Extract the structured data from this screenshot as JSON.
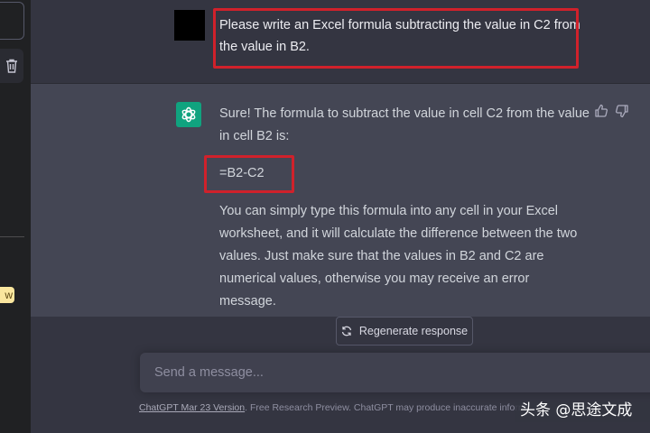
{
  "sidebar": {
    "badge_text": "w"
  },
  "user_message": {
    "text": "Please write an Excel formula subtracting the value in C2 from the value in B2."
  },
  "assistant_message": {
    "intro": "Sure! The formula to subtract the value in cell C2 from the value in cell B2 is:",
    "formula": "=B2-C2",
    "explanation": "You can simply type this formula into any cell in your Excel worksheet, and it will calculate the difference between the two values. Just make sure that the values in B2 and C2 are numerical values, otherwise you may receive an error message."
  },
  "actions": {
    "regenerate_label": "Regenerate response"
  },
  "composer": {
    "placeholder": "Send a message..."
  },
  "footer": {
    "version_link": "ChatGPT Mar 23 Version",
    "disclaimer": ". Free Research Preview. ChatGPT may produce inaccurate inform"
  },
  "watermark": {
    "text": "头条 @思途文成"
  },
  "colors": {
    "background": "#343541",
    "assistant_background": "#444654",
    "sidebar": "#202123",
    "accent_green": "#10a37f",
    "highlight_red": "#d0212b"
  },
  "icons": [
    "trash-icon",
    "openai-logo-icon",
    "thumbs-up-icon",
    "thumbs-down-icon",
    "refresh-icon"
  ]
}
